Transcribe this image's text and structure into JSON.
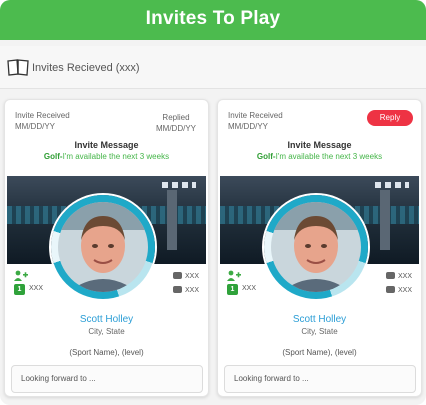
{
  "header": {
    "title": "Invites To Play"
  },
  "invites_bar": {
    "label": "Invites Recieved (xxx)",
    "icon": "book-icon"
  },
  "colors": {
    "accent": "#4cbb4e",
    "reply": "#ee3344",
    "name": "#2c9ed6",
    "message": "#44b548"
  },
  "cards": [
    {
      "received_label": "Invite Received",
      "received_date": "MM/DD/YY",
      "status_line1": "Replied",
      "status_line2": "MM/DD/YY",
      "message_title": "Invite Message",
      "message_prefix": "Golf-",
      "message_text": "I'm available the next 3 weeks",
      "left_stat": "XXX",
      "right_stat_1": "XXX",
      "right_stat_2": "XXX",
      "player_name": "Scott Holley",
      "location": "City, State",
      "sport": "(Sport Name), (level)",
      "note": "Looking forward to ..."
    },
    {
      "received_label": "Invite Received",
      "received_date": "MM/DD/YY",
      "reply_label": "Reply",
      "message_title": "Invite Message",
      "message_prefix": "Golf-",
      "message_text": "I'm available the next 3 weeks",
      "left_stat": "XXX",
      "right_stat_1": "XXX",
      "right_stat_2": "XXX",
      "player_name": "Scott Holley",
      "location": "City, State",
      "sport": "(Sport Name), (level)",
      "note": "Looking forward to ..."
    }
  ]
}
